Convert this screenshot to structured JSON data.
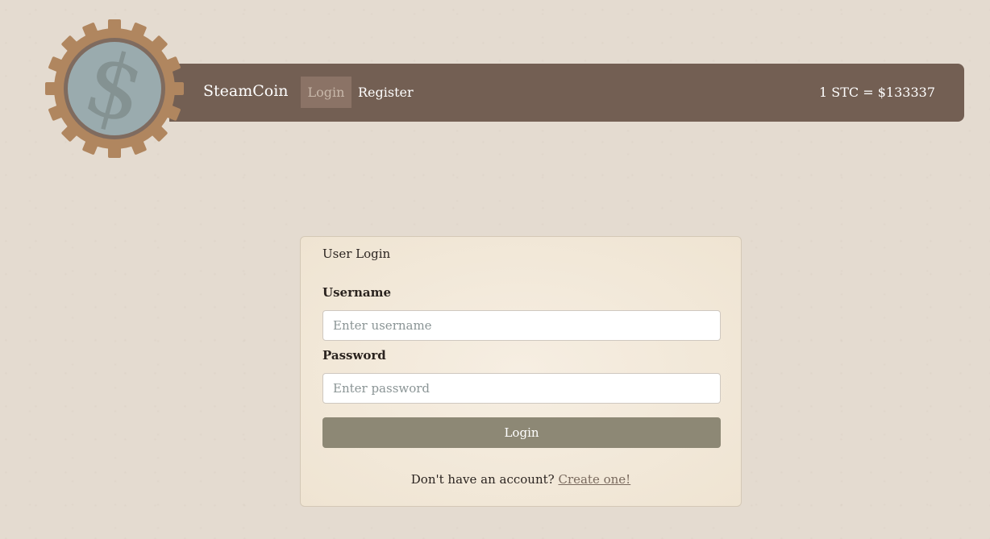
{
  "brand": {
    "name": "SteamCoin",
    "logo_icon": "gear-dollar-coin-icon"
  },
  "nav": {
    "login_label": "Login",
    "register_label": "Register"
  },
  "ticker": {
    "text": "1 STC = $133337"
  },
  "login_card": {
    "title": "User Login",
    "username_label": "Username",
    "username_placeholder": "Enter username",
    "password_label": "Password",
    "password_placeholder": "Enter password",
    "submit_label": "Login",
    "signup_prompt": "Don't have an account?",
    "signup_link": "Create one!"
  },
  "colors": {
    "page_bg": "#e4dbd0",
    "navbar_bg": "#735f53",
    "nav_active_bg": "#8b7366",
    "gear": "#b0865f",
    "coin": "#9aabae",
    "button_bg": "#8d8875",
    "card_bg": "#f4ebdc"
  }
}
